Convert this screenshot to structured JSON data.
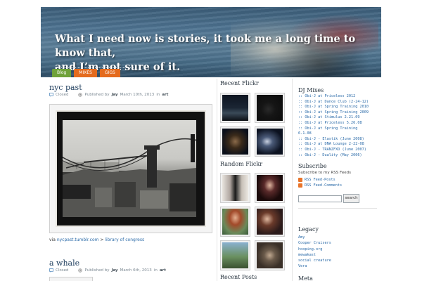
{
  "blog": {
    "title_line1": "What I need now is stories, it took me a long time to know that,",
    "title_line2": "and I’m not sure of it."
  },
  "nav": {
    "tabs": [
      {
        "label": "Blog",
        "color": "#6fa23a"
      },
      {
        "label": "MIXES",
        "color": "#e46b1e"
      },
      {
        "label": "GIGS",
        "color": "#e46b1e"
      }
    ]
  },
  "posts": [
    {
      "title": "nyc past",
      "status": "Closed",
      "published_prefix": "Published by",
      "author": "Jay",
      "date": "March 10th, 2013",
      "in_label": "in",
      "category": "art",
      "via_label": "via",
      "source_link": "nycpast.tumblr.com",
      "separator": ">",
      "source_link2": "library of congress"
    },
    {
      "title": "a whale",
      "status": "Closed",
      "published_prefix": "Published by",
      "author": "Jay",
      "date": "March 6th, 2013",
      "in_label": "in",
      "category": "art"
    }
  ],
  "sidebar_mid": {
    "recent_flickr": "Recent Flickr",
    "random_flickr": "Random Flickr",
    "recent_posts": "Recent Posts"
  },
  "sidebar_right": {
    "dj_mixes_title": "DJ Mixes",
    "dj_mixes": [
      ":: Obi-J at Priceless 2012",
      ":: Obi-J at Dance Club (2-24-12)",
      ":: Obi-J at Spring Training 2010",
      ":: Obi-J at Spring Training 2009",
      ":: Obi-J at Stimulus 2.21.09",
      ":: Obi-J at Priceless 5.26.08",
      ":: Obi-J at Spring Training",
      "6.1.08",
      ":: Obi-J - Elastik (June 2008)",
      ":: Obi-J at DNA Lounge 2-22-08",
      ":: Obi-J - TRANZFXD (June 2007)",
      ":: Obi-J - Duality (May 2006)"
    ],
    "subscribe_title": "Subscribe",
    "subscribe_text": "Subscribe to my RSS Feeds",
    "feed_posts": "RSS Feed-Posts",
    "feed_comments": "RSS Feed-Comments",
    "search_button": "search",
    "legacy_title": "Legacy",
    "legacy_links": [
      "Amy",
      "Cooper Cruisers",
      "hooping.org",
      "mewakast",
      "social creature",
      "Vera"
    ],
    "meta_title": "Meta"
  }
}
